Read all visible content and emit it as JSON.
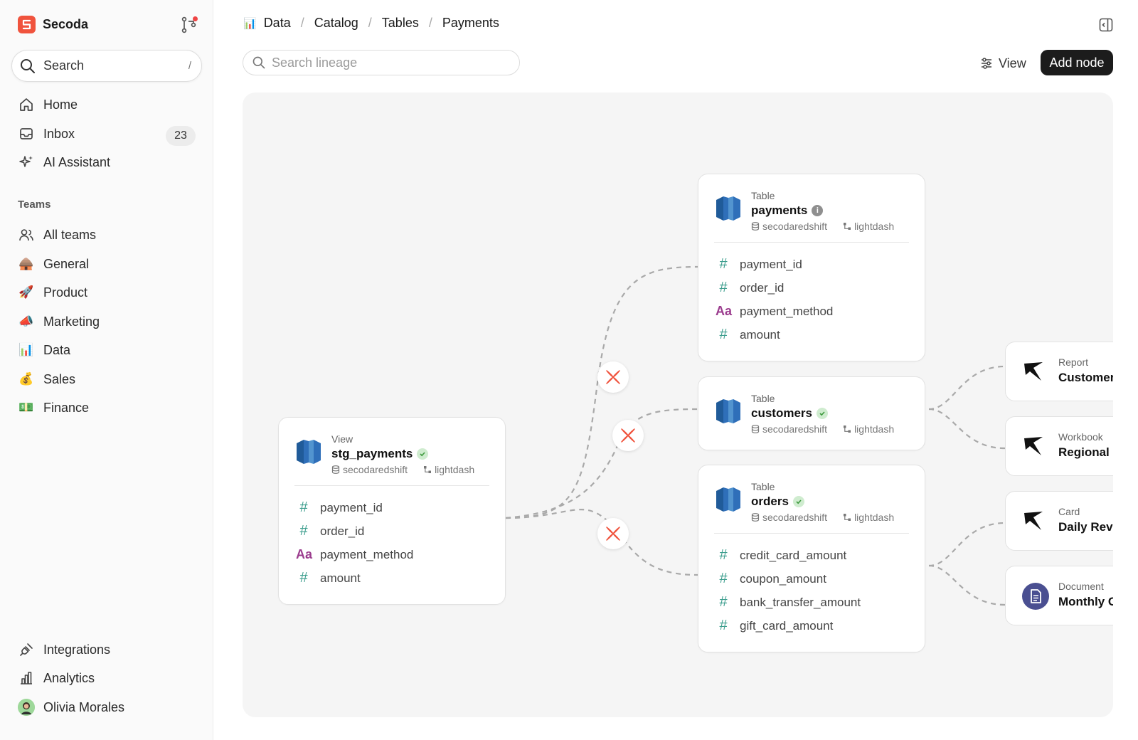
{
  "app": {
    "name": "Secoda"
  },
  "sidebar": {
    "search": {
      "label": "Search",
      "shortcut": "/"
    },
    "nav": [
      {
        "label": "Home",
        "icon": "home-icon"
      },
      {
        "label": "Inbox",
        "icon": "inbox-icon",
        "badge": "23"
      },
      {
        "label": "AI Assistant",
        "icon": "sparkles-icon"
      }
    ],
    "teams_label": "Teams",
    "teams": [
      {
        "label": "All teams",
        "icon": "users-icon"
      },
      {
        "label": "General",
        "icon": "🛖"
      },
      {
        "label": "Product",
        "icon": "🚀"
      },
      {
        "label": "Marketing",
        "icon": "📣"
      },
      {
        "label": "Data",
        "icon": "📊"
      },
      {
        "label": "Sales",
        "icon": "💰"
      },
      {
        "label": "Finance",
        "icon": "💵"
      }
    ],
    "bottom": [
      {
        "label": "Integrations",
        "icon": "plug-icon"
      },
      {
        "label": "Analytics",
        "icon": "bar-chart-icon"
      },
      {
        "label": "Olivia Morales",
        "icon": "avatar"
      }
    ]
  },
  "breadcrumb": {
    "items": [
      "Data",
      "Catalog",
      "Tables",
      "Payments"
    ],
    "icon": "📊"
  },
  "toolbar": {
    "search_placeholder": "Search lineage",
    "view_label": "View",
    "add_node_label": "Add node"
  },
  "lineage": {
    "source": {
      "type": "View",
      "name": "stg_payments",
      "status": "verified",
      "database": "secodaredshift",
      "project": "lightdash",
      "columns": [
        {
          "name": "payment_id",
          "kind": "number"
        },
        {
          "name": "order_id",
          "kind": "number"
        },
        {
          "name": "payment_method",
          "kind": "string"
        },
        {
          "name": "amount",
          "kind": "number"
        }
      ]
    },
    "tables": [
      {
        "type": "Table",
        "name": "payments",
        "status": "info",
        "database": "secodaredshift",
        "project": "lightdash",
        "columns": [
          {
            "name": "payment_id",
            "kind": "number"
          },
          {
            "name": "order_id",
            "kind": "number"
          },
          {
            "name": "payment_method",
            "kind": "string"
          },
          {
            "name": "amount",
            "kind": "number"
          }
        ]
      },
      {
        "type": "Table",
        "name": "customers",
        "status": "verified",
        "database": "secodaredshift",
        "project": "lightdash",
        "columns": []
      },
      {
        "type": "Table",
        "name": "orders",
        "status": "verified",
        "database": "secodaredshift",
        "project": "lightdash",
        "columns": [
          {
            "name": "credit_card_amount",
            "kind": "number"
          },
          {
            "name": "coupon_amount",
            "kind": "number"
          },
          {
            "name": "bank_transfer_amount",
            "kind": "number"
          },
          {
            "name": "gift_card_amount",
            "kind": "number"
          }
        ]
      }
    ],
    "downstream": [
      {
        "type": "Report",
        "name": "Customer",
        "icon": "lightdash-icon"
      },
      {
        "type": "Workbook",
        "name": "Regional",
        "icon": "lightdash-icon"
      },
      {
        "type": "Card",
        "name": "Daily Reve",
        "icon": "lightdash-icon"
      },
      {
        "type": "Document",
        "name": "Monthly C",
        "icon": "document-icon"
      }
    ],
    "colors": {
      "number_type": "#3d9e8e",
      "string_type": "#9b3c8e",
      "dbt": "#f0533d",
      "redshift": "#2f6fb9"
    }
  }
}
